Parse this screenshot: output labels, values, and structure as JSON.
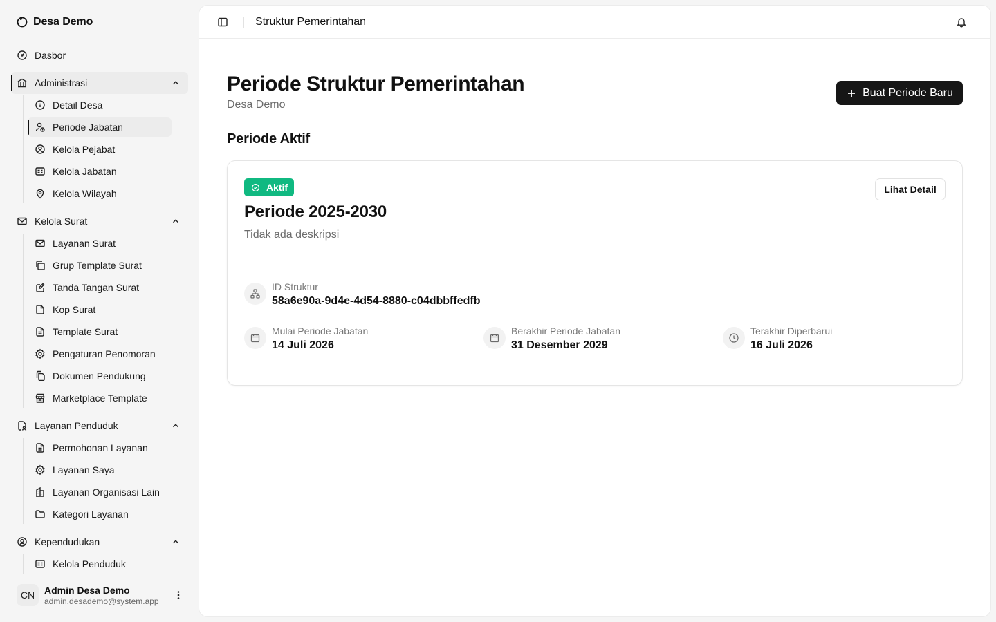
{
  "sidebar": {
    "brand": "Desa Demo",
    "dashboard": "Dasbor",
    "groups": [
      {
        "label": "Administrasi",
        "items": [
          "Detail Desa",
          "Periode Jabatan",
          "Kelola Pejabat",
          "Kelola Jabatan",
          "Kelola Wilayah"
        ]
      },
      {
        "label": "Kelola Surat",
        "items": [
          "Layanan Surat",
          "Grup Template Surat",
          "Tanda Tangan Surat",
          "Kop Surat",
          "Template Surat",
          "Pengaturan Penomoran",
          "Dokumen Pendukung",
          "Marketplace Template"
        ]
      },
      {
        "label": "Layanan Penduduk",
        "items": [
          "Permohonan Layanan",
          "Layanan Saya",
          "Layanan Organisasi Lain",
          "Kategori Layanan"
        ]
      },
      {
        "label": "Kependudukan",
        "items": [
          "Kelola Penduduk"
        ]
      }
    ],
    "user": {
      "initials": "CN",
      "name": "Admin Desa Demo",
      "email": "admin.desademo@system.app"
    }
  },
  "topbar": {
    "title": "Struktur Pemerintahan"
  },
  "page": {
    "title": "Periode Struktur Pemerintahan",
    "subtitle": "Desa Demo",
    "new_button": "Buat Periode Baru",
    "section_title": "Periode Aktif"
  },
  "card": {
    "badge": "Aktif",
    "title": "Periode 2025-2030",
    "description": "Tidak ada deskripsi",
    "detail_button": "Lihat Detail",
    "id_label": "ID Struktur",
    "id_value": "58a6e90a-9d4e-4d54-8880-c04dbbffedfb",
    "start_label": "Mulai Periode Jabatan",
    "start_value": "14 Juli 2026",
    "end_label": "Berakhir Periode Jabatan",
    "end_value": "31 Desember 2029",
    "updated_label": "Terakhir Diperbarui",
    "updated_value": "16 Juli 2026"
  },
  "colors": {
    "accent": "#161616",
    "status_active": "#10b981",
    "sidebar_bg": "#f5f5f5"
  }
}
